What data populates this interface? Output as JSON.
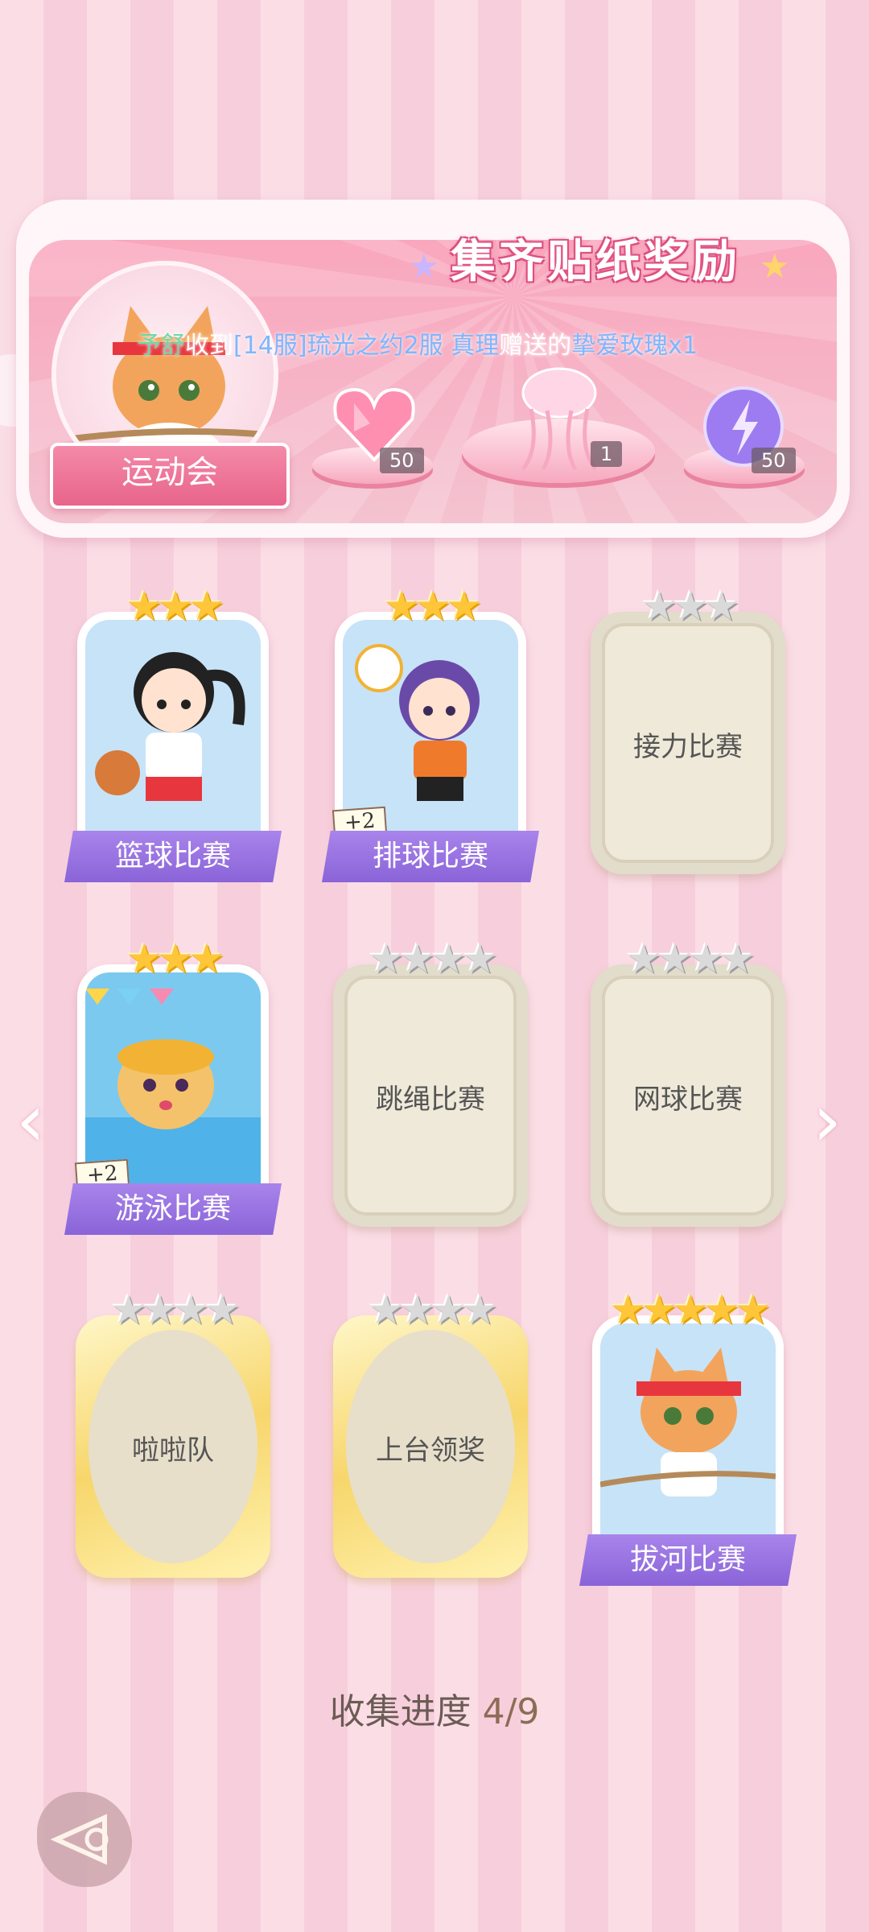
{
  "banner": {
    "title": "集齐贴纸奖励",
    "event_name": "运动会",
    "ticker": {
      "part1": "予舒",
      "part2": "收到",
      "part3": "[14服]",
      "part4": "琉光之约2服 真理",
      "part5": "赠送的",
      "part6": "挚爱玫瑰x1"
    },
    "rewards": [
      {
        "icon": "pink-heart-gem-icon",
        "count": "50"
      },
      {
        "icon": "jellyfish-outfit-icon",
        "count": "1"
      },
      {
        "icon": "purple-energy-orb-icon",
        "count": "50"
      }
    ]
  },
  "cards": [
    {
      "label": "篮球比赛",
      "stars": 3,
      "stars_max": 3,
      "collected": true,
      "bonus": "",
      "art": "basketball-girl"
    },
    {
      "label": "排球比赛",
      "stars": 3,
      "stars_max": 3,
      "collected": true,
      "bonus": "+2",
      "art": "volleyball-girl"
    },
    {
      "label": "接力比赛",
      "stars": 0,
      "stars_max": 3,
      "collected": false,
      "bonus": ""
    },
    {
      "label": "游泳比赛",
      "stars": 3,
      "stars_max": 3,
      "collected": true,
      "bonus": "+2",
      "art": "swimming-puppy"
    },
    {
      "label": "跳绳比赛",
      "stars": 0,
      "stars_max": 4,
      "collected": false,
      "bonus": ""
    },
    {
      "label": "网球比赛",
      "stars": 0,
      "stars_max": 4,
      "collected": false,
      "bonus": ""
    },
    {
      "label": "啦啦队",
      "stars": 0,
      "stars_max": 4,
      "collected": false,
      "bonus": "",
      "style": "gold-oval"
    },
    {
      "label": "上台领奖",
      "stars": 0,
      "stars_max": 4,
      "collected": false,
      "bonus": "",
      "style": "gold-oval"
    },
    {
      "label": "拔河比赛",
      "stars": 5,
      "stars_max": 5,
      "collected": true,
      "bonus": "",
      "art": "tug-of-war-cat"
    }
  ],
  "progress": {
    "label": "收集进度",
    "value": "4/9"
  },
  "nav": {
    "prev_icon": "chevron-left-icon",
    "next_icon": "chevron-right-icon",
    "back_icon": "back-arrow-icon"
  },
  "colors": {
    "accent_pink": "#e8648b",
    "label_purple": "#8a64d8",
    "star_gold": "#ffc63a",
    "star_grey": "#dadada"
  }
}
